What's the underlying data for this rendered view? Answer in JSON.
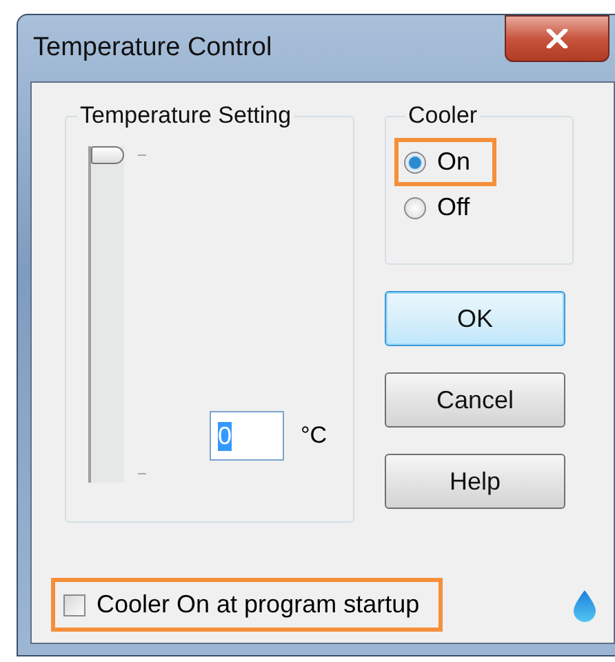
{
  "window": {
    "title": "Temperature Control"
  },
  "temperature_setting": {
    "title": "Temperature Setting",
    "slider": {
      "level": 1
    },
    "value": "0",
    "value_selected": true,
    "unit": "°C"
  },
  "cooler": {
    "title": "Cooler",
    "options": [
      {
        "label": "On",
        "selected": true,
        "highlighted": true
      },
      {
        "label": "Off",
        "selected": false,
        "highlighted": false
      }
    ]
  },
  "buttons": [
    {
      "label": "OK",
      "default": true
    },
    {
      "label": "Cancel",
      "default": false
    },
    {
      "label": "Help",
      "default": false
    }
  ],
  "startup": {
    "label": "Cooler On at program startup",
    "checked": false,
    "highlighted": true
  }
}
